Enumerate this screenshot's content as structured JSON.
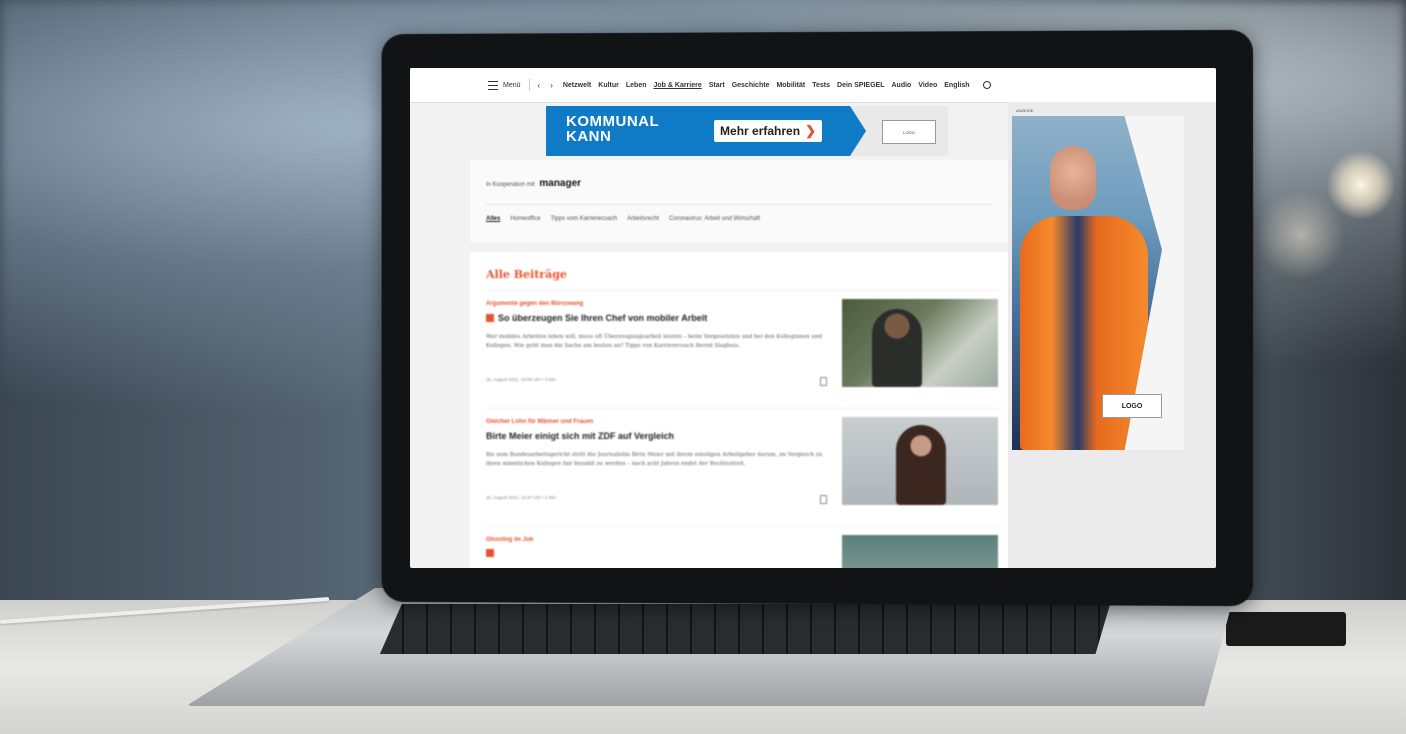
{
  "nav": {
    "menu_label": "Menü",
    "items": [
      "Netzwelt",
      "Kultur",
      "Leben",
      "Job & Karriere",
      "Start",
      "Geschichte",
      "Mobilität",
      "Tests",
      "Dein SPIEGEL",
      "Audio",
      "Video",
      "English"
    ],
    "active_index": 3
  },
  "ad_banner": {
    "title_line1": "KOMMUNAL",
    "title_line2": "KANN",
    "cta": "Mehr erfahren",
    "logo": "LOGO",
    "accent_color": "#0f7bc6",
    "cta_arrow_color": "#e8502e"
  },
  "cooperation": {
    "prefix": "In Kooperation mit",
    "partner": "manager",
    "tabs": [
      "Alles",
      "Homeoffice",
      "Tipps vom Karrierecoach",
      "Arbeitsrecht",
      "Coronavirus: Arbeit und Wirtschaft"
    ]
  },
  "feed": {
    "title": "Alle Beiträge",
    "articles": [
      {
        "kicker": "Argumente gegen den Bürozwang",
        "headline": "So überzeugen Sie Ihren Chef von mobiler Arbeit",
        "body": "Wer mobiles Arbeiten leben will, muss oft Überzeugungsarbeit leisten – beim Vorgesetzten und bei den Kolleginnen und Kollegen. Wie geht man die Sache am besten an? Tipps von Karrierecoach Bernd Slaghuis.",
        "meta": "25. August 2021, 10:06 Uhr • 3 Min"
      },
      {
        "kicker": "Gleicher Lohn für Männer und Frauen",
        "headline": "Birte Meier einigt sich mit ZDF auf Vergleich",
        "body": "Bis zum Bundesarbeitsgericht stritt die Journalistin Birte Meier mit ihrem einstigen Arbeitgeber darum, im Vergleich zu ihren männlichen Kollegen fair bezahlt zu werden – nach acht Jahren endet der Rechtsstreit.",
        "meta": "25. August 2021, 10:47 Uhr • 2 Min"
      },
      {
        "kicker": "Ghosting im Job",
        "headline": "",
        "body": "",
        "meta": ""
      }
    ]
  },
  "sidebar_ad": {
    "label": "ANZEIGE",
    "logo": "LOGO"
  }
}
